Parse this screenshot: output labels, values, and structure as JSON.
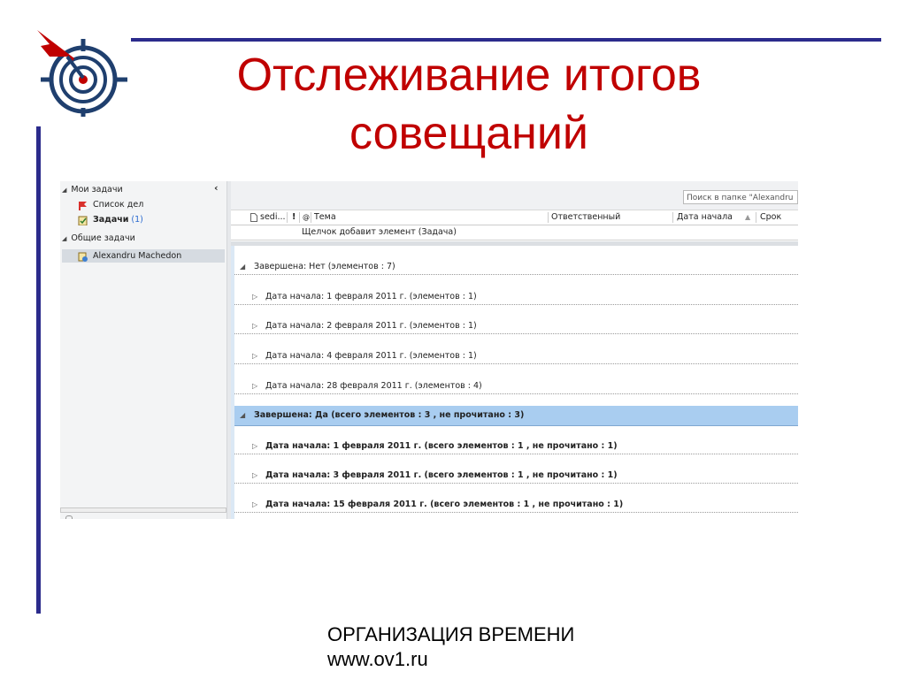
{
  "slide": {
    "title_line1": "Отслеживание итогов",
    "title_line2": "совещаний",
    "footer_line1": "ОРГАНИЗАЦИЯ ВРЕМЕНИ",
    "footer_line2": "www.ov1.ru",
    "accent_color": "#c00000",
    "rule_color": "#2b2b8c"
  },
  "nav": {
    "collapse_glyph": "‹",
    "my_tasks": "Мои задачи",
    "todo_list": "Список дел",
    "tasks_label": "Задачи",
    "tasks_count": "(1)",
    "shared_tasks": "Общие задачи",
    "shared_user": "Alexandru Machedon"
  },
  "toolbar": {
    "search_placeholder": "Поиск в папке \"Alexandru"
  },
  "columns": {
    "icon_col": "sedi...",
    "importance_col": "!",
    "attachment_col": "@",
    "subject": "Тема",
    "owner": "Ответственный",
    "start_date": "Дата начала",
    "due": "Срок"
  },
  "new_item_hint": "Щелчок добавит элемент (Задача)",
  "groups": [
    {
      "level": 0,
      "expanded": true,
      "bold": false,
      "selected": false,
      "text": "Завершена: Нет (элементов : 7)"
    },
    {
      "level": 1,
      "expanded": false,
      "bold": false,
      "selected": false,
      "text": "Дата начала: 1 февраля 2011 г. (элементов : 1)"
    },
    {
      "level": 1,
      "expanded": false,
      "bold": false,
      "selected": false,
      "text": "Дата начала: 2 февраля 2011 г. (элементов : 1)"
    },
    {
      "level": 1,
      "expanded": false,
      "bold": false,
      "selected": false,
      "text": "Дата начала: 4 февраля 2011 г. (элементов : 1)"
    },
    {
      "level": 1,
      "expanded": false,
      "bold": false,
      "selected": false,
      "text": "Дата начала: 28 февраля 2011 г. (элементов : 4)"
    },
    {
      "level": 0,
      "expanded": true,
      "bold": true,
      "selected": true,
      "text": "Завершена: Да  (всего элементов : 3 , не прочитано : 3)"
    },
    {
      "level": 1,
      "expanded": false,
      "bold": true,
      "selected": false,
      "text": "Дата начала: 1 февраля 2011 г.  (всего элементов : 1 , не прочитано : 1)"
    },
    {
      "level": 1,
      "expanded": false,
      "bold": true,
      "selected": false,
      "text": "Дата начала: 3 февраля 2011 г.  (всего элементов : 1 , не прочитано : 1)"
    },
    {
      "level": 1,
      "expanded": false,
      "bold": true,
      "selected": false,
      "text": "Дата начала: 15 февраля 2011 г.  (всего элементов : 1 , не прочитано : 1)"
    }
  ]
}
